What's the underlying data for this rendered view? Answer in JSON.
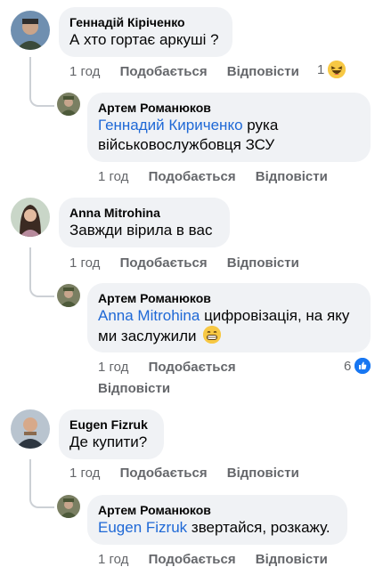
{
  "colors": {
    "mention": "#1e68d6",
    "meta": "#65676b",
    "bubble": "#f0f2f5",
    "like": "#1877f2"
  },
  "comments": [
    {
      "author": "Геннадій Кіріченко",
      "text": "А хто гортає аркуші ?",
      "time": "1 год",
      "like_label": "Подобається",
      "reply_label": "Відповісти",
      "reaction_count": "1",
      "reaction_icon": "laughing-emoji-icon",
      "reply": {
        "author": "Артем Романюков",
        "mention": "Геннадий Кириченко",
        "text_line1": " рука",
        "text_line2": "військовослужбовця ЗСУ",
        "time": "1 год",
        "like_label": "Подобається",
        "reply_label": "Відповісти"
      }
    },
    {
      "author": "Anna Mitrohina",
      "text": "Завжди вірила в вас",
      "time": "1 год",
      "like_label": "Подобається",
      "reply_label": "Відповісти",
      "reply": {
        "author": "Артем Романюков",
        "mention": "Anna Mitrohina",
        "text_line1": " цифровізація, на яку",
        "text_line2": "ми заслужили",
        "text_emoji": "grinning-emoji-icon",
        "time": "1 год",
        "like_label": "Подобається",
        "reply_label": "Відповісти",
        "reaction_count": "6",
        "reaction_icon": "like-icon"
      }
    },
    {
      "author": "Eugen Fizruk",
      "text": "Де купити?",
      "time": "1 год",
      "like_label": "Подобається",
      "reply_label": "Відповісти",
      "reply": {
        "author": "Артем Романюков",
        "mention": "Eugen Fizruk",
        "text_line1": " звертайся, розкажу.",
        "time": "1 год",
        "like_label": "Подобається",
        "reply_label": "Відповісти"
      }
    }
  ]
}
